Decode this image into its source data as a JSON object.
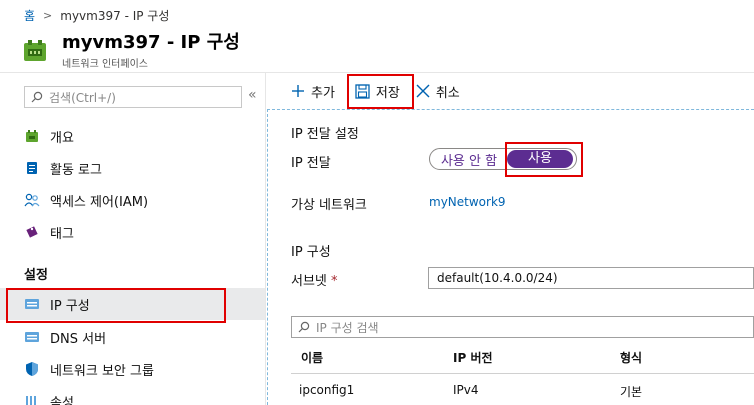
{
  "breadcrumb": {
    "home": "홈",
    "separator": ">",
    "current": "myvm397 - IP 구성"
  },
  "header": {
    "title": "myvm397 - IP 구성",
    "subtitle": "네트워크 인터페이스",
    "icon": "network-interface-icon"
  },
  "sidebar": {
    "search_placeholder": "검색(Ctrl+/)",
    "collapse": "«",
    "items": [
      {
        "label": "개요",
        "icon": "overview-icon"
      },
      {
        "label": "활동 로그",
        "icon": "activity-log-icon"
      },
      {
        "label": "액세스 제어(IAM)",
        "icon": "iam-icon"
      },
      {
        "label": "태그",
        "icon": "tag-icon"
      }
    ],
    "section_title": "설정",
    "settings_items": [
      {
        "label": "IP 구성",
        "icon": "ip-config-icon",
        "active": true
      },
      {
        "label": "DNS 서버",
        "icon": "dns-server-icon"
      },
      {
        "label": "네트워크 보안 그룹",
        "icon": "nsg-icon"
      },
      {
        "label": "속성",
        "icon": "properties-icon"
      }
    ]
  },
  "toolbar": {
    "add": "추가",
    "save": "저장",
    "cancel": "취소"
  },
  "form": {
    "forwarding_section": "IP 전달 설정",
    "forwarding_label": "IP 전달",
    "toggle_off": "사용 안 함",
    "toggle_on": "사용",
    "vnet_label": "가상 네트워크",
    "vnet_value": "myNetwork9",
    "ip_section": "IP 구성",
    "subnet_label": "서브넷",
    "required_mark": "*",
    "subnet_value": "default(10.4.0.0/24)",
    "ip_search_placeholder": "IP 구성 검색"
  },
  "table": {
    "headers": [
      "이름",
      "IP 버전",
      "형식"
    ],
    "rows": [
      [
        "ipconfig1",
        "IPv4",
        "기본"
      ]
    ]
  },
  "colors": {
    "accent": "#0063b1",
    "toggle_on": "#5c2d91",
    "highlight": "#e00000"
  }
}
